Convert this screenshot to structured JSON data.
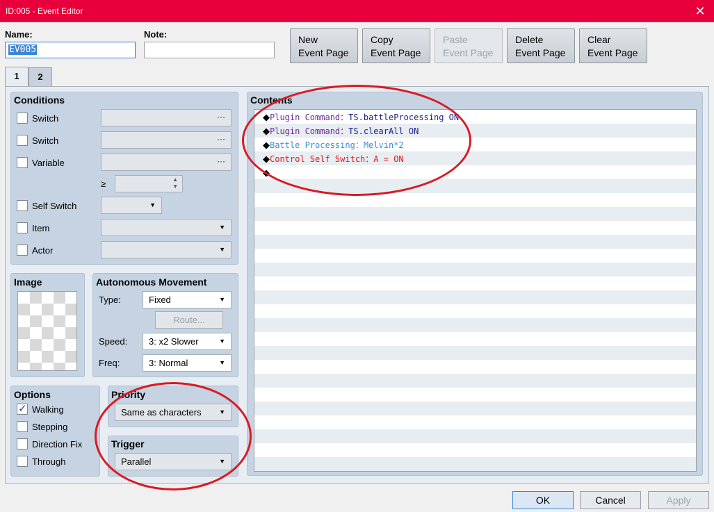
{
  "window": {
    "title": "ID:005 - Event Editor",
    "close_glyph": "✕"
  },
  "name": {
    "label": "Name:",
    "value": "EV005"
  },
  "note": {
    "label": "Note:",
    "value": ""
  },
  "page_buttons": [
    {
      "line1": "New",
      "line2": "Event Page"
    },
    {
      "line1": "Copy",
      "line2": "Event Page"
    },
    {
      "line1": "Paste",
      "line2": "Event Page"
    },
    {
      "line1": "Delete",
      "line2": "Event Page"
    },
    {
      "line1": "Clear",
      "line2": "Event Page"
    }
  ],
  "tabs": [
    "1",
    "2"
  ],
  "conditions": {
    "title": "Conditions",
    "rows": [
      "Switch",
      "Switch",
      "Variable",
      "Self Switch",
      "Item",
      "Actor"
    ],
    "gte": "≥"
  },
  "image": {
    "title": "Image"
  },
  "movement": {
    "title": "Autonomous Movement",
    "type_label": "Type:",
    "type_value": "Fixed",
    "route_label": "Route...",
    "speed_label": "Speed:",
    "speed_value": "3: x2 Slower",
    "freq_label": "Freq:",
    "freq_value": "3: Normal"
  },
  "options": {
    "title": "Options",
    "items": [
      {
        "label": "Walking",
        "checked": true
      },
      {
        "label": "Stepping",
        "checked": false
      },
      {
        "label": "Direction Fix",
        "checked": false
      },
      {
        "label": "Through",
        "checked": false
      }
    ]
  },
  "priority": {
    "title": "Priority",
    "value": "Same as characters"
  },
  "trigger": {
    "title": "Trigger",
    "value": "Parallel"
  },
  "contents": {
    "title": "Contents",
    "commands": [
      {
        "name": "Plugin Command",
        "sep": "：",
        "arg": "TS.battleProcessing ON",
        "name_color": "#6a2a9c",
        "arg_color": "#1c1c8c"
      },
      {
        "name": "Plugin Command",
        "sep": "：",
        "arg": "TS.clearAll ON",
        "name_color": "#6a2a9c",
        "arg_color": "#1c1c8c"
      },
      {
        "name": "Battle Processing",
        "sep": "：",
        "arg": "Melvin*2",
        "name_color": "#3b8fd6",
        "arg_color": "#3b8fd6"
      },
      {
        "name": "Control Self Switch",
        "sep": "：",
        "arg": "A = ON",
        "name_color": "#e01a1a",
        "arg_color": "#e01a1a"
      },
      {
        "name": "",
        "sep": "",
        "arg": "",
        "name_color": "#000000",
        "arg_color": "#000000"
      }
    ]
  },
  "footer": {
    "ok": "OK",
    "cancel": "Cancel",
    "apply": "Apply"
  },
  "colors": {
    "titlebar": "#e8003c",
    "annotation": "#d91a24"
  }
}
